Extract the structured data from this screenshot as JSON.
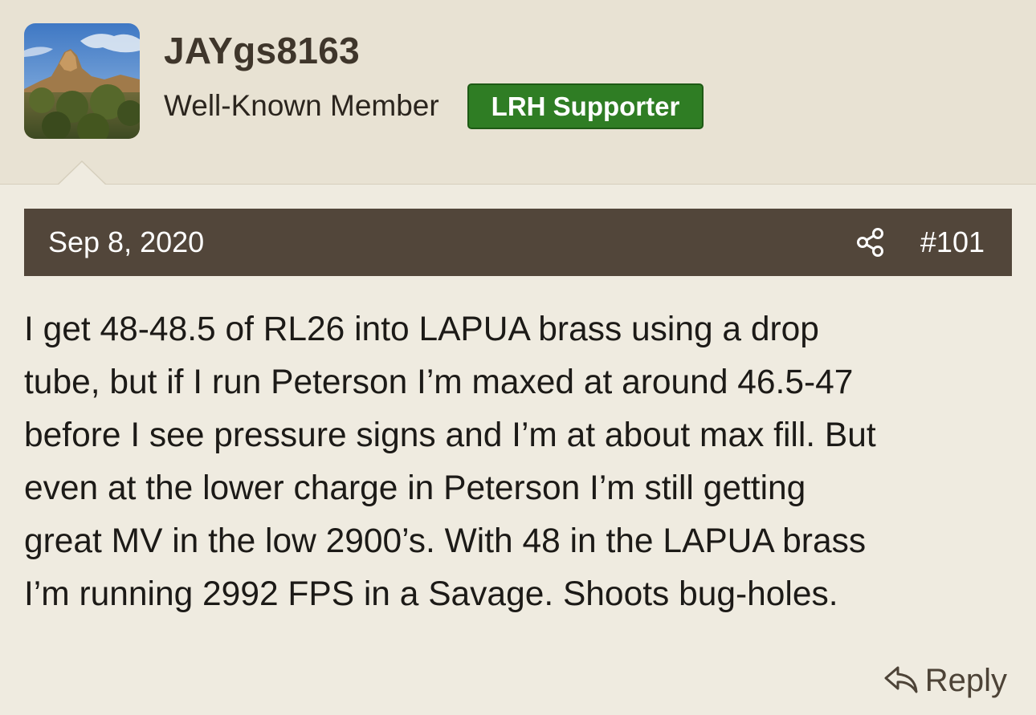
{
  "user": {
    "username": "JAYgs8163",
    "title": "Well-Known Member",
    "badge": "LRH Supporter"
  },
  "post": {
    "date": "Sep 8, 2020",
    "number": "#101",
    "body_lines": [
      "I get 48-48.5 of RL26 into LAPUA brass using a drop",
      "tube, but if I run Peterson I’m maxed at around 46.5-47",
      "before I see pressure signs and I’m at about max fill. But",
      "even at the lower charge in Peterson I’m still getting",
      "great MV in the low 2900’s. With 48 in the LAPUA brass",
      "I’m running 2992 FPS in a Savage. Shoots bug-holes."
    ]
  },
  "actions": {
    "reply_label": "Reply"
  },
  "icons": {
    "share": "share-icon",
    "reply": "reply-icon"
  },
  "colors": {
    "header_bg": "#e8e2d3",
    "page_bg": "#efebe0",
    "post_bar": "#52463a",
    "badge_green": "#2f7d24",
    "username": "#3f362b"
  }
}
